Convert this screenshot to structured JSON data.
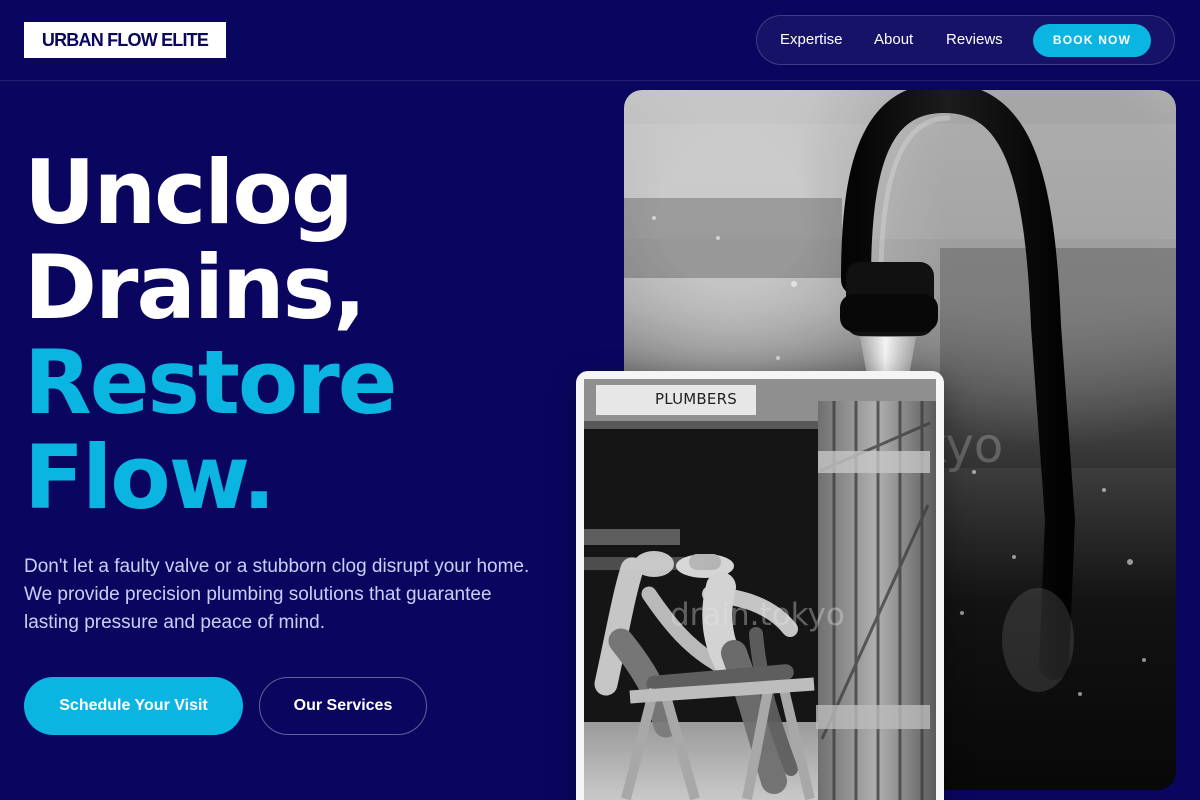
{
  "brand": {
    "name": "URBAN FLOW ELITE"
  },
  "nav": {
    "items": [
      {
        "label": "Expertise"
      },
      {
        "label": "About"
      },
      {
        "label": "Reviews"
      }
    ],
    "cta_label": "BOOK NOW"
  },
  "hero": {
    "title_lines": [
      "Unclog",
      "Drains,",
      "Restore",
      "Flow."
    ],
    "description": "Don't let a faulty valve or a stubborn clog disrupt your home. We provide precision plumbing solutions that guarantee lasting pressure and peace of mind.",
    "primary_cta": "Schedule Your Visit",
    "secondary_cta": "Our Services"
  },
  "images": {
    "main_watermark": "okyo",
    "small_watermark": "drain.tokyo",
    "small_sign": "PLUMBERS"
  },
  "colors": {
    "background": "#0a0660",
    "accent": "#0bb5e2",
    "text": "#ffffff",
    "muted_text": "#c7d1f6"
  }
}
